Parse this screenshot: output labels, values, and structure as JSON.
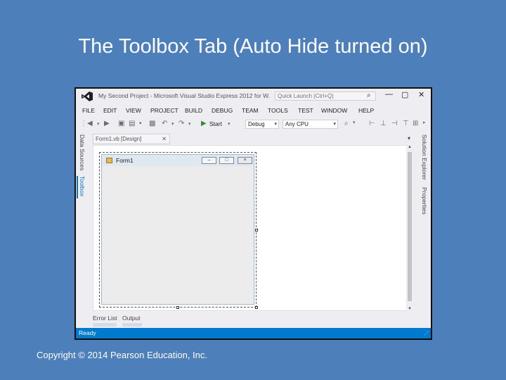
{
  "slide": {
    "title": "The Toolbox Tab (Auto Hide turned on)",
    "copyright": "Copyright © 2014 Pearson Education, Inc."
  },
  "window": {
    "title": "My Second Project - Microsoft Visual Studio Express 2012 for W...",
    "quick_launch_placeholder": "Quick Launch (Ctrl+Q)",
    "controls": {
      "minimize": "—",
      "maximize": "▢",
      "close": "✕"
    }
  },
  "menu": [
    "FILE",
    "EDIT",
    "VIEW",
    "PROJECT",
    "BUILD",
    "DEBUG",
    "TEAM",
    "TOOLS",
    "TEST",
    "WINDOW",
    "HELP"
  ],
  "toolbar": {
    "start_label": "Start",
    "configuration": "Debug",
    "platform": "Any CPU"
  },
  "left_tabs": {
    "data_sources": "Data Sources",
    "toolbox": "Toolbox"
  },
  "right_tabs": {
    "solution_explorer": "Solution Explorer",
    "properties": "Properties"
  },
  "document_tab": {
    "label": "Form1.vb [Design]",
    "close": "✕"
  },
  "form": {
    "title": "Form1"
  },
  "bottom_tabs": {
    "error_list": "Error List",
    "output": "Output"
  },
  "status": {
    "text": "Ready"
  },
  "colors": {
    "slide_bg": "#4d7fbb",
    "status_bar": "#007acc",
    "vs_logo": "#68217a",
    "selected_tab": "#0e70c0"
  }
}
